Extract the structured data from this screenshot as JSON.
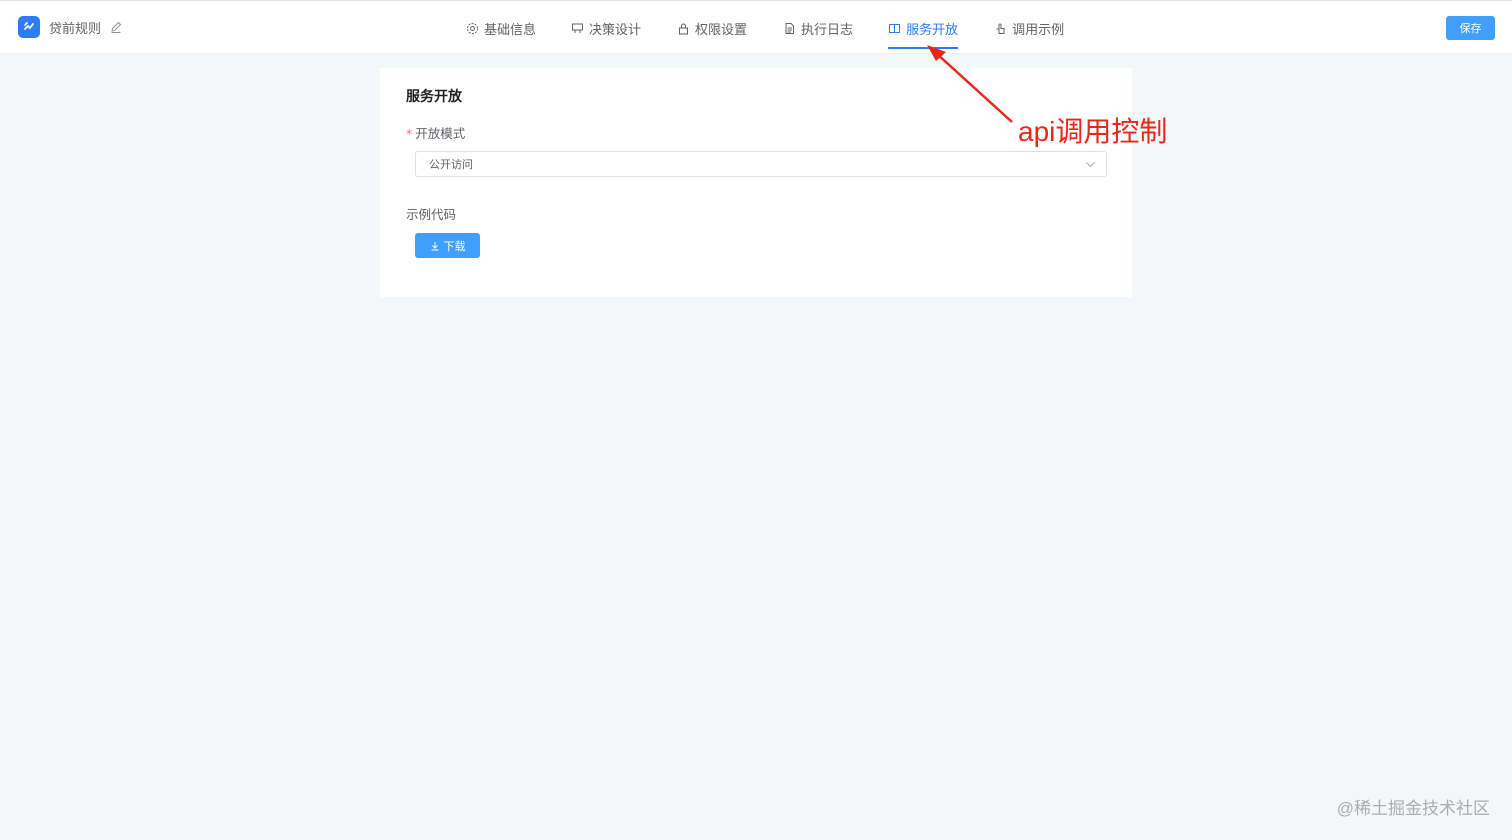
{
  "header": {
    "app_title": "贷前规则",
    "save_label": "保存"
  },
  "tabs": [
    {
      "label": "基础信息",
      "icon": "gear-icon",
      "active": false
    },
    {
      "label": "决策设计",
      "icon": "flow-icon",
      "active": false
    },
    {
      "label": "权限设置",
      "icon": "lock-icon",
      "active": false
    },
    {
      "label": "执行日志",
      "icon": "document-icon",
      "active": false
    },
    {
      "label": "服务开放",
      "icon": "book-icon",
      "active": true
    },
    {
      "label": "调用示例",
      "icon": "pointer-icon",
      "active": false
    }
  ],
  "card": {
    "title": "服务开放",
    "mode_label": "开放模式",
    "mode_required_mark": "*",
    "mode_value": "公开访问",
    "code_label": "示例代码",
    "download_label": "下载"
  },
  "annotation": {
    "text": "api调用控制"
  },
  "watermark": "@稀土掘金技术社区",
  "colors": {
    "accent": "#2d7cf6",
    "button": "#409eff",
    "annotation": "#e8271c",
    "background": "#f4f7f8"
  }
}
